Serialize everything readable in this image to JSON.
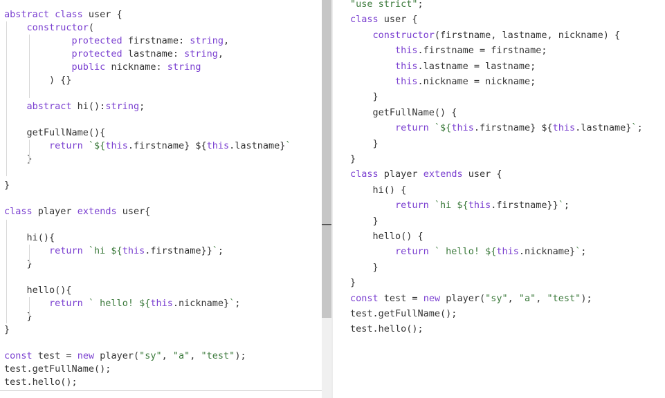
{
  "colors": {
    "keyword": "#7a3fd0",
    "string": "#3c7a3c",
    "text": "#333333",
    "guide": "#d8d8d8"
  },
  "left": {
    "lines": [
      [
        [
          "kw",
          "abstract class "
        ],
        [
          "plain",
          "user {"
        ]
      ],
      [
        [
          "kw",
          "    constructor"
        ],
        [
          "plain",
          "("
        ]
      ],
      [
        [
          "kw",
          "            protected "
        ],
        [
          "plain",
          "firstname: "
        ],
        [
          "ty",
          "string"
        ],
        [
          "plain",
          ","
        ]
      ],
      [
        [
          "kw",
          "            protected "
        ],
        [
          "plain",
          "lastname: "
        ],
        [
          "ty",
          "string"
        ],
        [
          "plain",
          ","
        ]
      ],
      [
        [
          "kw",
          "            public "
        ],
        [
          "plain",
          "nickname: "
        ],
        [
          "ty",
          "string"
        ]
      ],
      [
        [
          "plain",
          "        ) {}"
        ]
      ],
      [
        [
          "plain",
          ""
        ]
      ],
      [
        [
          "kw",
          "    abstract "
        ],
        [
          "plain",
          "hi():"
        ],
        [
          "ty",
          "string"
        ],
        [
          "plain",
          ";"
        ]
      ],
      [
        [
          "plain",
          ""
        ]
      ],
      [
        [
          "plain",
          "    getFullName(){"
        ]
      ],
      [
        [
          "kw",
          "        return "
        ],
        [
          "str",
          "`${"
        ],
        [
          "kw",
          "this"
        ],
        [
          "plain",
          ".firstname} ${"
        ],
        [
          "kw",
          "this"
        ],
        [
          "plain",
          ".lastname}"
        ],
        [
          "str",
          "`"
        ]
      ],
      [
        [
          "plain",
          "    }"
        ]
      ],
      [
        [
          "plain",
          ""
        ]
      ],
      [
        [
          "plain",
          "}"
        ]
      ],
      [
        [
          "plain",
          ""
        ]
      ],
      [
        [
          "kw",
          "class "
        ],
        [
          "plain",
          "player "
        ],
        [
          "kw",
          "extends "
        ],
        [
          "plain",
          "user{"
        ]
      ],
      [
        [
          "plain",
          ""
        ]
      ],
      [
        [
          "plain",
          "    hi(){"
        ]
      ],
      [
        [
          "kw",
          "        return "
        ],
        [
          "str",
          "`hi ${"
        ],
        [
          "kw",
          "this"
        ],
        [
          "plain",
          ".firstname}}"
        ],
        [
          "str",
          "`"
        ],
        [
          "plain",
          ";"
        ]
      ],
      [
        [
          "plain",
          "    }"
        ]
      ],
      [
        [
          "plain",
          ""
        ]
      ],
      [
        [
          "plain",
          "    hello(){"
        ]
      ],
      [
        [
          "kw",
          "        return "
        ],
        [
          "str",
          "` hello! ${"
        ],
        [
          "kw",
          "this"
        ],
        [
          "plain",
          ".nickname}"
        ],
        [
          "str",
          "`"
        ],
        [
          "plain",
          ";"
        ]
      ],
      [
        [
          "plain",
          "    }"
        ]
      ],
      [
        [
          "plain",
          "}"
        ]
      ],
      [
        [
          "plain",
          ""
        ]
      ],
      [
        [
          "kw",
          "const "
        ],
        [
          "plain",
          "test = "
        ],
        [
          "kw",
          "new "
        ],
        [
          "plain",
          "player("
        ],
        [
          "str",
          "\"sy\""
        ],
        [
          "plain",
          ", "
        ],
        [
          "str",
          "\"a\""
        ],
        [
          "plain",
          ", "
        ],
        [
          "str",
          "\"test\""
        ],
        [
          "plain",
          ");"
        ]
      ],
      [
        [
          "plain",
          "test.getFullName();"
        ]
      ],
      [
        [
          "plain",
          "test.hello();"
        ]
      ]
    ]
  },
  "right": {
    "lines": [
      [
        [
          "str",
          "\"use strict\""
        ],
        [
          "plain",
          ";"
        ]
      ],
      [
        [
          "kw",
          "class "
        ],
        [
          "plain",
          "user {"
        ]
      ],
      [
        [
          "kw",
          "    constructor"
        ],
        [
          "plain",
          "(firstname, lastname, nickname) {"
        ]
      ],
      [
        [
          "kw",
          "        this"
        ],
        [
          "plain",
          ".firstname = firstname;"
        ]
      ],
      [
        [
          "kw",
          "        this"
        ],
        [
          "plain",
          ".lastname = lastname;"
        ]
      ],
      [
        [
          "kw",
          "        this"
        ],
        [
          "plain",
          ".nickname = nickname;"
        ]
      ],
      [
        [
          "plain",
          "    }"
        ]
      ],
      [
        [
          "plain",
          "    getFullName() {"
        ]
      ],
      [
        [
          "kw",
          "        return "
        ],
        [
          "str",
          "`${"
        ],
        [
          "kw",
          "this"
        ],
        [
          "plain",
          ".firstname} ${"
        ],
        [
          "kw",
          "this"
        ],
        [
          "plain",
          ".lastname}"
        ],
        [
          "str",
          "`"
        ],
        [
          "plain",
          ";"
        ]
      ],
      [
        [
          "plain",
          "    }"
        ]
      ],
      [
        [
          "plain",
          "}"
        ]
      ],
      [
        [
          "kw",
          "class "
        ],
        [
          "plain",
          "player "
        ],
        [
          "kw",
          "extends "
        ],
        [
          "plain",
          "user {"
        ]
      ],
      [
        [
          "plain",
          "    hi() {"
        ]
      ],
      [
        [
          "kw",
          "        return "
        ],
        [
          "str",
          "`hi ${"
        ],
        [
          "kw",
          "this"
        ],
        [
          "plain",
          ".firstname}}"
        ],
        [
          "str",
          "`"
        ],
        [
          "plain",
          ";"
        ]
      ],
      [
        [
          "plain",
          "    }"
        ]
      ],
      [
        [
          "plain",
          "    hello() {"
        ]
      ],
      [
        [
          "kw",
          "        return "
        ],
        [
          "str",
          "` hello! ${"
        ],
        [
          "kw",
          "this"
        ],
        [
          "plain",
          ".nickname}"
        ],
        [
          "str",
          "`"
        ],
        [
          "plain",
          ";"
        ]
      ],
      [
        [
          "plain",
          "    }"
        ]
      ],
      [
        [
          "plain",
          "}"
        ]
      ],
      [
        [
          "kw",
          "const "
        ],
        [
          "plain",
          "test = "
        ],
        [
          "kw",
          "new "
        ],
        [
          "plain",
          "player("
        ],
        [
          "str",
          "\"sy\""
        ],
        [
          "plain",
          ", "
        ],
        [
          "str",
          "\"a\""
        ],
        [
          "plain",
          ", "
        ],
        [
          "str",
          "\"test\""
        ],
        [
          "plain",
          ");"
        ]
      ],
      [
        [
          "plain",
          "test.getFullName();"
        ]
      ],
      [
        [
          "plain",
          "test.hello();"
        ]
      ]
    ]
  }
}
